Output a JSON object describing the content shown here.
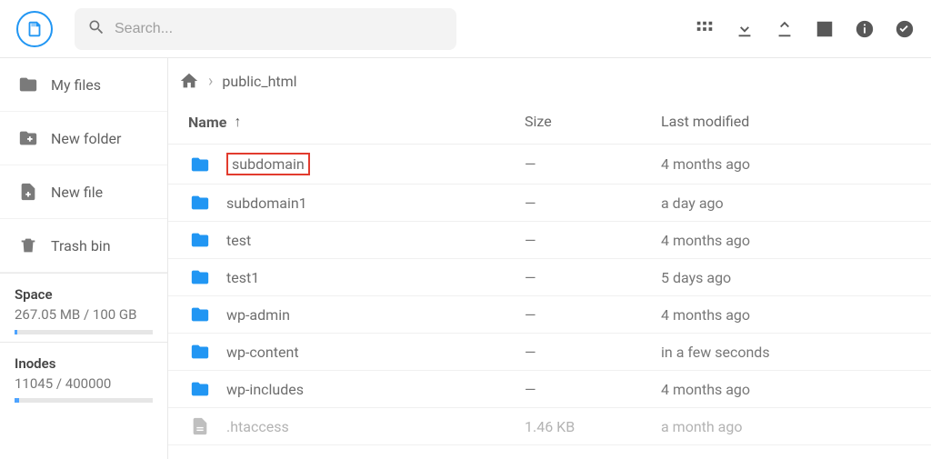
{
  "header": {
    "search_placeholder": "Search..."
  },
  "sidebar": {
    "items": [
      {
        "label": "My files"
      },
      {
        "label": "New folder"
      },
      {
        "label": "New file"
      },
      {
        "label": "Trash bin"
      }
    ],
    "space": {
      "title": "Space",
      "text": "267.05 MB / 100 GB",
      "pct": 2
    },
    "inodes": {
      "title": "Inodes",
      "text": "11045 / 400000",
      "pct": 3
    }
  },
  "breadcrumb": {
    "current": "public_html"
  },
  "columns": {
    "name": "Name",
    "size": "Size",
    "modified": "Last modified"
  },
  "rows": [
    {
      "type": "folder",
      "name": "subdomain",
      "size": "—",
      "modified": "4 months ago",
      "highlight": true
    },
    {
      "type": "folder",
      "name": "subdomain1",
      "size": "—",
      "modified": "a day ago"
    },
    {
      "type": "folder",
      "name": "test",
      "size": "—",
      "modified": "4 months ago"
    },
    {
      "type": "folder",
      "name": "test1",
      "size": "—",
      "modified": "5 days ago"
    },
    {
      "type": "folder",
      "name": "wp-admin",
      "size": "—",
      "modified": "4 months ago"
    },
    {
      "type": "folder",
      "name": "wp-content",
      "size": "—",
      "modified": "in a few seconds"
    },
    {
      "type": "folder",
      "name": "wp-includes",
      "size": "—",
      "modified": "4 months ago"
    },
    {
      "type": "file",
      "name": ".htaccess",
      "size": "1.46 KB",
      "modified": "a month ago",
      "dim": true
    }
  ]
}
